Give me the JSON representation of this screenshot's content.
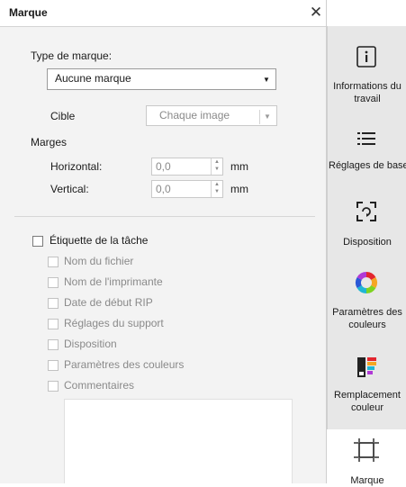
{
  "panel": {
    "title": "Marque",
    "type_label": "Type de marque:",
    "type_value": "Aucune marque",
    "target_label": "Cible",
    "target_value": "Chaque image",
    "margins_label": "Marges",
    "horizontal_label": "Horizontal:",
    "horizontal_value": "0,0",
    "vertical_label": "Vertical:",
    "vertical_value": "0,0",
    "unit": "mm",
    "job_label_title": "Étiquette de la tâche",
    "job_label_options": [
      "Nom du fichier",
      "Nom de l'imprimante",
      "Date de début RIP",
      "Réglages du support",
      "Disposition",
      "Paramètres des couleurs",
      "Commentaires"
    ]
  },
  "rail": {
    "items": [
      {
        "label_line1": "Informations du",
        "label_line2": "travail",
        "icon": "info-icon"
      },
      {
        "label_line1": "Réglages de base",
        "label_line2": "",
        "icon": "list-icon"
      },
      {
        "label_line1": "Disposition",
        "label_line2": "",
        "icon": "layout-icon"
      },
      {
        "label_line1": "Paramètres des",
        "label_line2": "couleurs",
        "icon": "color-wheel-icon"
      },
      {
        "label_line1": "Remplacement",
        "label_line2": "couleur",
        "icon": "color-replace-icon"
      },
      {
        "label_line1": "Marque",
        "label_line2": "",
        "icon": "crop-marks-icon"
      }
    ]
  }
}
